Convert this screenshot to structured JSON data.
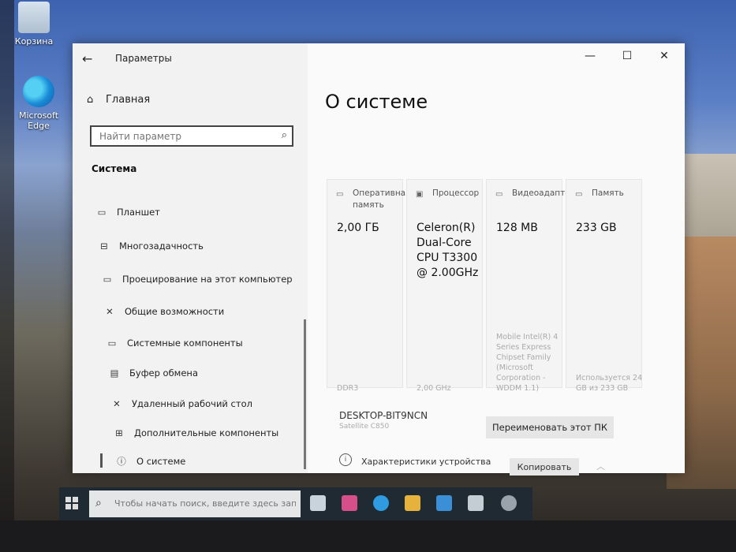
{
  "desktop": {
    "icons": [
      {
        "name": "recycle-bin",
        "label": "Корзина"
      },
      {
        "name": "microsoft-edge",
        "label": "Microsoft Edge"
      }
    ]
  },
  "window": {
    "app_title": "Параметры",
    "back_icon": "arrow-left-icon",
    "controls": {
      "minimize": "—",
      "maximize": "☐",
      "close": "✕"
    }
  },
  "sidebar": {
    "home_label": "Главная",
    "search_placeholder": "Найти параметр",
    "section_title": "Система",
    "items": [
      {
        "label": "Планшет",
        "icon": "tablet-icon"
      },
      {
        "label": "Многозадачность",
        "icon": "multitasking-icon"
      },
      {
        "label": "Проецирование на этот компьютер",
        "icon": "projecting-icon"
      },
      {
        "label": "Общие возможности",
        "icon": "shared-experiences-icon"
      },
      {
        "label": "Системные компоненты",
        "icon": "system-components-icon"
      },
      {
        "label": "Буфер обмена",
        "icon": "clipboard-icon"
      },
      {
        "label": "Удаленный рабочий стол",
        "icon": "remote-desktop-icon"
      },
      {
        "label": "Дополнительные компоненты",
        "icon": "optional-features-icon"
      },
      {
        "label": "О системе",
        "icon": "info-icon"
      }
    ]
  },
  "main": {
    "page_title": "О системе",
    "cards": [
      {
        "title": "Оперативная память",
        "value": "2,00 ГБ",
        "note": "DDR3",
        "icon": "ram-icon"
      },
      {
        "title": "Процессор",
        "value": "Celeron(R) Dual-Core CPU T3300 @ 2.00GHz",
        "note": "2,00 GHz",
        "icon": "cpu-icon"
      },
      {
        "title": "Видеоадаптер",
        "value": "128 MB",
        "note": "Mobile Intel(R) 4 Series Express Chipset Family (Microsoft Corporation - WDDM 1.1)",
        "icon": "gpu-icon"
      },
      {
        "title": "Память",
        "value": "233 GB",
        "note": "Используется 24 GB из 233 GB",
        "icon": "storage-icon"
      }
    ],
    "device_name": "DESKTOP-BIT9NCN",
    "device_model": "Satellite C850",
    "rename_button": "Переименовать этот ПК",
    "specs_label": "Характеристики устройства",
    "copy_button": "Копировать"
  },
  "taskbar": {
    "search_placeholder": "Чтобы начать поиск, введите здесь запрос"
  }
}
